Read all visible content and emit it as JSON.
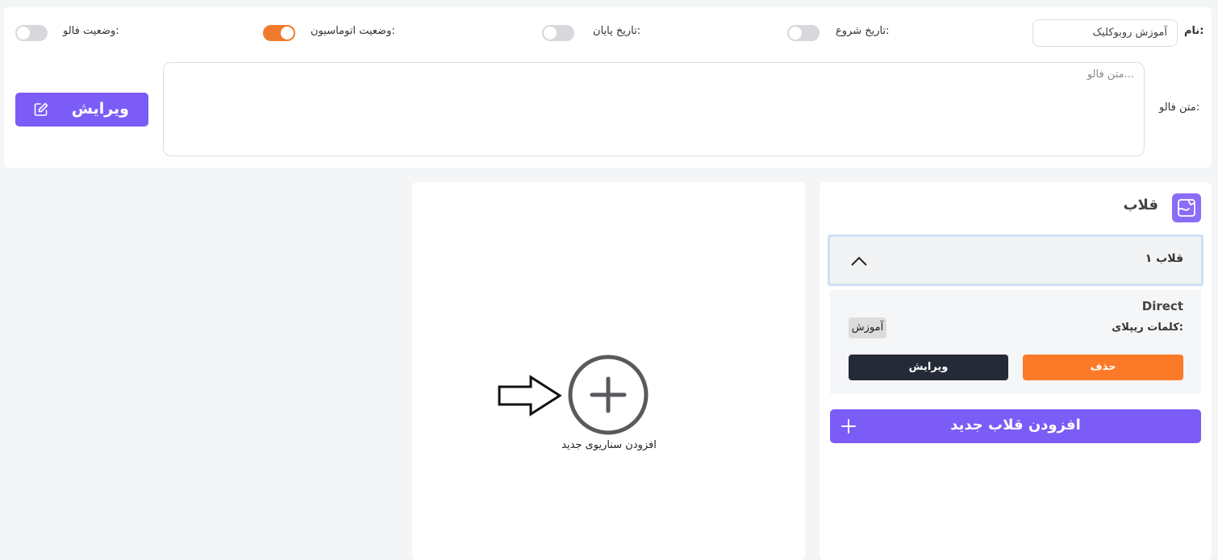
{
  "form": {
    "name_label": "نام:",
    "name_value": "آموزش روبوکلیک",
    "start_date_label": "تاریخ شروع:",
    "start_date_enabled": false,
    "end_date_label": "تاریخ پایان:",
    "end_date_enabled": false,
    "automation_status_label": "وضعیت اتوماسیون:",
    "automation_status_enabled": true,
    "follow_status_label": "وضعیت فالو:",
    "follow_status_enabled": false,
    "follow_text_label": "متن فالو:",
    "follow_text_placeholder": "متن فالو...",
    "edit_button_label": "ویرایش"
  },
  "scenario": {
    "add_label": "افزودن سناریوی جدید"
  },
  "templates": {
    "title": "قلاب",
    "items": [
      {
        "title": "قلاب ۱",
        "type": "Direct",
        "reply_words_label": "کلمات ریپلای:",
        "reply_words": [
          "آموزش"
        ],
        "delete_label": "حذف",
        "edit_label": "ویرایش"
      }
    ],
    "add_button_label": "افزودن قلاب جدید"
  },
  "colors": {
    "accent": "#7b5cf6",
    "toggle_on": "#f07a2c",
    "delete": "#fb7a28",
    "dark_button": "#252a38"
  }
}
